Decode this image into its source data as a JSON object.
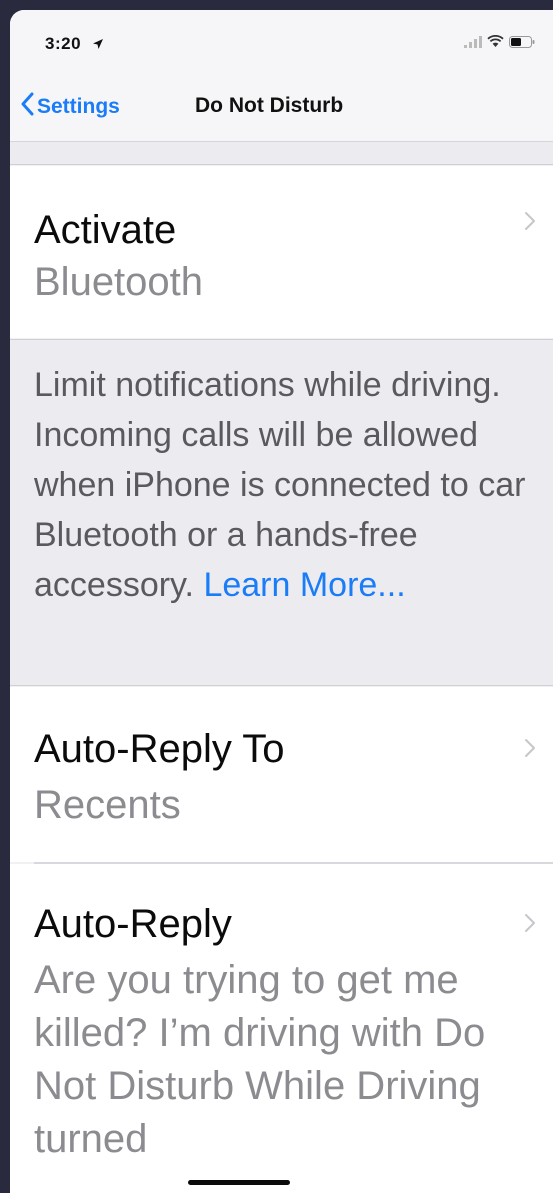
{
  "status": {
    "time": "3:20",
    "location_icon": "location-arrow-icon",
    "signal_icon": "cellular-signal-icon",
    "wifi_icon": "wifi-icon",
    "battery_icon": "battery-icon"
  },
  "nav": {
    "back_label": "Settings",
    "title": "Do Not Disturb"
  },
  "activate": {
    "title": "Activate",
    "value": "Bluetooth"
  },
  "footer": {
    "text": "Limit notifications while driving. Incoming calls will be allowed when iPhone is connected to car Bluetooth or a hands-free accessory.",
    "link": "Learn More..."
  },
  "auto_reply_to": {
    "title": "Auto-Reply To",
    "value": "Recents"
  },
  "auto_reply": {
    "title": "Auto-Reply",
    "value": "Are you trying to get me killed? I’m driving with Do Not Disturb While Driving turned"
  },
  "colors": {
    "accent": "#1a7cf6",
    "background": "#f1f1f4",
    "secondary_text": "#8b8b90"
  }
}
